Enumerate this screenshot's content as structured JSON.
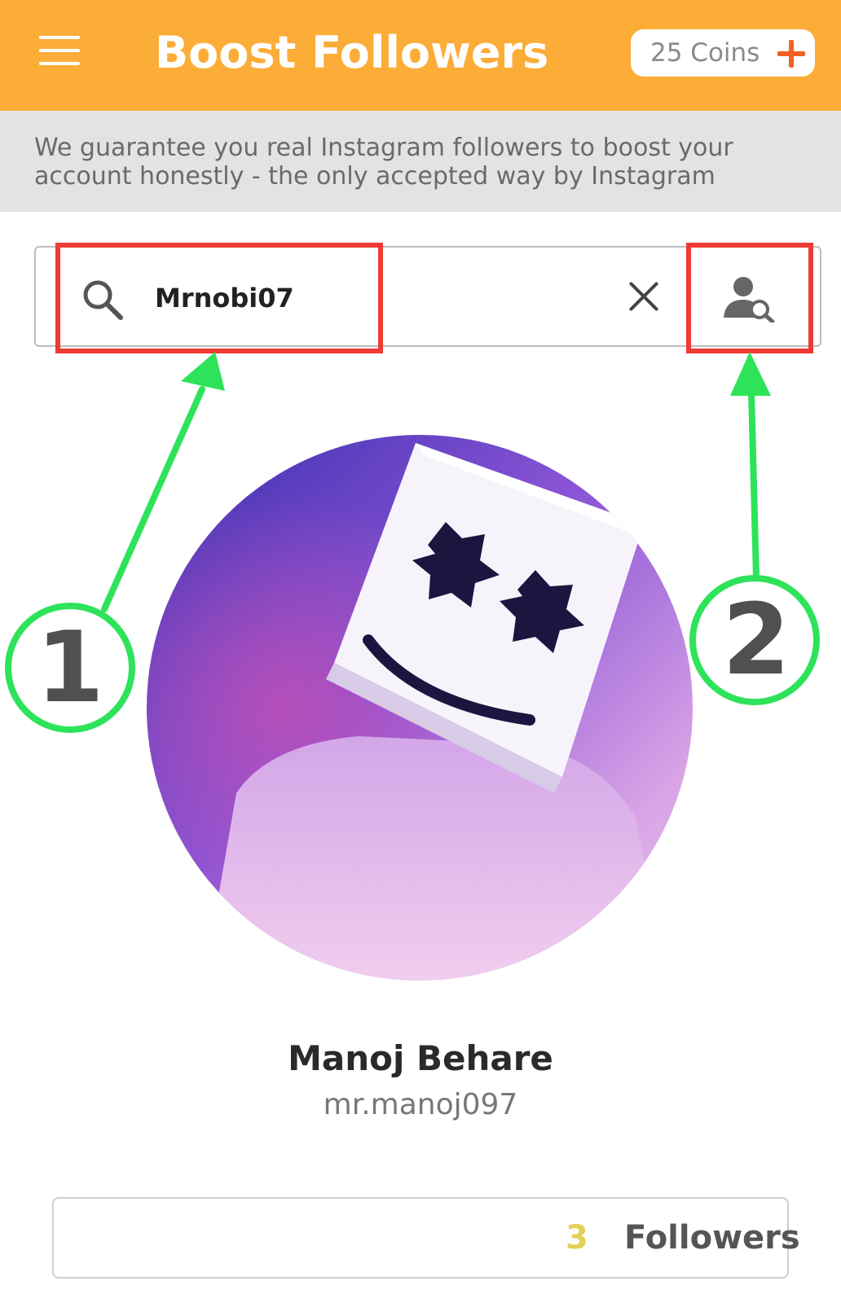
{
  "header": {
    "title": "Boost Followers",
    "coins_label": "25 Coins",
    "menu_icon": "hamburger-menu-icon",
    "add_icon": "plus-icon",
    "bar_color": "#FBAD38",
    "accent_color": "#F26122"
  },
  "banner": {
    "text": "We guarantee you real Instagram followers to boost your account honestly - the only accepted way by Instagram"
  },
  "search": {
    "value": "Mrnobi07",
    "search_icon": "search-icon",
    "clear_icon": "close-icon",
    "find_user_icon": "user-search-icon"
  },
  "annotations": {
    "one": "1",
    "two": "2",
    "box_color": "#EE3B33",
    "arrow_color": "#2EE35A"
  },
  "profile": {
    "name": "Manoj Behare",
    "username": "mr.manoj097"
  },
  "followers": {
    "count": "3",
    "label": "Followers",
    "count_color": "#E5D05A"
  }
}
